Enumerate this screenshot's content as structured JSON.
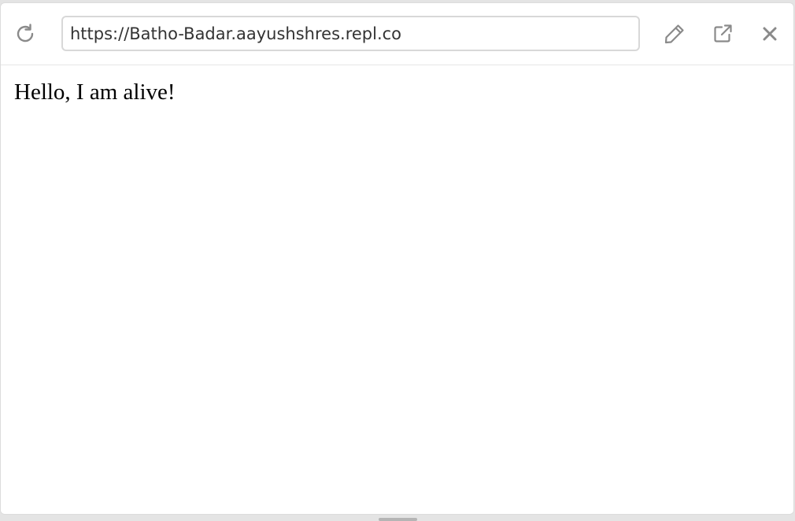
{
  "toolbar": {
    "url_value": "https://Batho-Badar.aayushshres.repl.co",
    "icons": {
      "reload": "reload-icon",
      "edit": "pencil-icon",
      "open": "external-link-icon",
      "close": "close-icon"
    },
    "icon_color": "#8a8a8a"
  },
  "content": {
    "text": "Hello, I am alive!"
  }
}
